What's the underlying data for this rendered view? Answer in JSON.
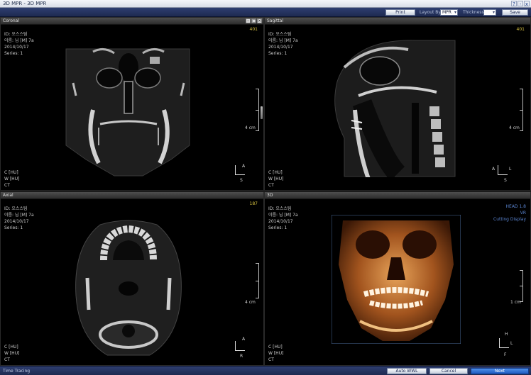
{
  "window": {
    "title": "3D MPR - 3D MPR",
    "buttons": [
      "?",
      "-",
      "x"
    ]
  },
  "toolbar": {
    "print_label": "Print",
    "layout_label": "Layout By",
    "layout_value": "MPR",
    "thickness_label": "Thickness",
    "thickness_value": "",
    "save_label": "Save"
  },
  "views": {
    "coronal": {
      "title": "Coronal",
      "slice": "401",
      "info": [
        "ID: 오스스팀",
        "이름: 님 [M] 7a",
        "2014/10/17",
        "Series: 1"
      ],
      "footer": [
        "C [HU]",
        "W [HU]",
        "CT"
      ],
      "scale": "4 cm",
      "orient_top": "A",
      "orient_bottom": "S"
    },
    "sagittal": {
      "title": "Sagittal",
      "slice": "401",
      "info": [
        "ID: 오스스팀",
        "이름: 님 [M] 7a",
        "2014/10/17",
        "Series: 1"
      ],
      "footer": [
        "C [HU]",
        "W [HU]",
        "CT"
      ],
      "scale": "4 cm",
      "orient_top": "A",
      "orient_right": "L",
      "orient_bottom": "S"
    },
    "axial": {
      "title": "Axial",
      "slice": "187",
      "info": [
        "ID: 오스스팀",
        "이름: 님 [M] 7a",
        "2014/10/17",
        "Series: 1"
      ],
      "footer": [
        "C [HU]",
        "W [HU]",
        "CT"
      ],
      "scale": "4 cm",
      "orient_top": "A",
      "orient_bottom": "R"
    },
    "3d": {
      "title": "3D",
      "info": [
        "ID: 오스스팀",
        "이름: 님 [M] 7a",
        "2014/10/17",
        "Series: 1"
      ],
      "legend": [
        "HEAD 1.8",
        "VR",
        "Cutting Display"
      ],
      "footer": [
        "C [HU]",
        "W [HU]",
        "CT"
      ],
      "scale": "1 cm",
      "orient_top": "H",
      "orient_right": "L",
      "orient_bottom": "F"
    }
  },
  "statusbar": {
    "title": "Time Tracing",
    "btn1": "Auto WWL",
    "btn2": "Cancel",
    "btn3": "Next"
  },
  "colors": {
    "slice_number": "#d6c040",
    "legend": "#5a84d0",
    "primary_button": "#2f6fd8"
  }
}
